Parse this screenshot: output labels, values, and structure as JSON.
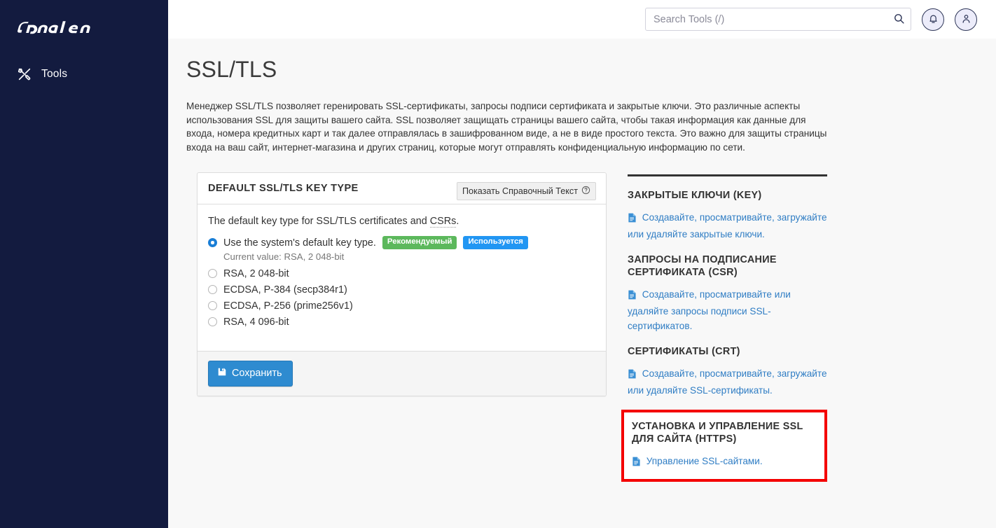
{
  "sidebar": {
    "brand": "cPanel",
    "items": [
      {
        "label": "Tools",
        "icon": "tools-icon"
      }
    ]
  },
  "topbar": {
    "search": {
      "placeholder": "Search Tools (/)",
      "value": ""
    },
    "search_icon": "search-icon",
    "notifications_icon": "bell-icon",
    "account_icon": "user-icon"
  },
  "page": {
    "title": "SSL/TLS",
    "description": "Менеджер SSL/TLS позволяет геренировать SSL-сертификаты, запросы подписи сертификата и закрытые ключи. Это различные аспекты использования SSL для защиты вашего сайта. SSL позволяет защищать страницы вашего сайта, чтобы такая информация как данные для входа, номера кредитных карт и так далее отправлялась в зашифрованном виде, а не в виде простого текста. Это важно для защиты страницы входа на ваш сайт, интернет-магазина и других страниц, которые могут отправлять конфиденциальную информацию по сети."
  },
  "panel": {
    "title": "DEFAULT SSL/TLS KEY TYPE",
    "help_button": "Показать Справочный Текст",
    "help_icon": "question-circle-icon",
    "lead_before": "The default key type for SSL/TLS certificates and ",
    "lead_abbr": "CSRs",
    "lead_after": ".",
    "default_option": {
      "label": "Use the system's default key type.",
      "badge_recommended": "Рекомендуемый",
      "badge_in_use": "Используется",
      "current_value": "Current value: RSA, 2 048-bit",
      "selected": true
    },
    "options": [
      {
        "label": "RSA, 2 048-bit",
        "selected": false
      },
      {
        "label": "ECDSA, P-384 (secp384r1)",
        "selected": false
      },
      {
        "label": "ECDSA, P-256 (prime256v1)",
        "selected": false
      },
      {
        "label": "RSA, 4 096-bit",
        "selected": false
      }
    ],
    "save_button": "Сохранить",
    "save_icon": "floppy-save-icon"
  },
  "links": {
    "sections": [
      {
        "title": "ЗАКРЫТЫЕ КЛЮЧИ",
        "paren": " (KEY)",
        "link": "Создавайте, просматривайте, загружайте или удаляйте закрытые ключи.",
        "icon": "document-icon",
        "highlighted": false
      },
      {
        "title": "ЗАПРОСЫ НА ПОДПИСАНИЕ СЕРТИФИКАТА",
        "paren": " (CSR)",
        "link": "Создавайте, просматривайте или удаляйте запросы подписи SSL-сертификатов.",
        "icon": "document-icon",
        "highlighted": false
      },
      {
        "title": "СЕРТИФИКАТЫ",
        "paren": " (CRT)",
        "link": "Создавайте, просматривайте, загружайте или удаляйте SSL-сертификаты.",
        "icon": "document-icon",
        "highlighted": false
      },
      {
        "title": "УСТАНОВКА И УПРАВЛЕНИЕ SSL ДЛЯ САЙТА",
        "paren": " (HTTPS)",
        "link": "Управление SSL-сайтами.",
        "icon": "document-icon",
        "highlighted": true
      }
    ]
  },
  "colors": {
    "sidebar_bg": "#131b3f",
    "accent_blue": "#2e8bd0",
    "link_blue": "#2f7dc4",
    "badge_green": "#5cb85c",
    "badge_blue": "#2196f3",
    "highlight_red": "#f40000"
  }
}
